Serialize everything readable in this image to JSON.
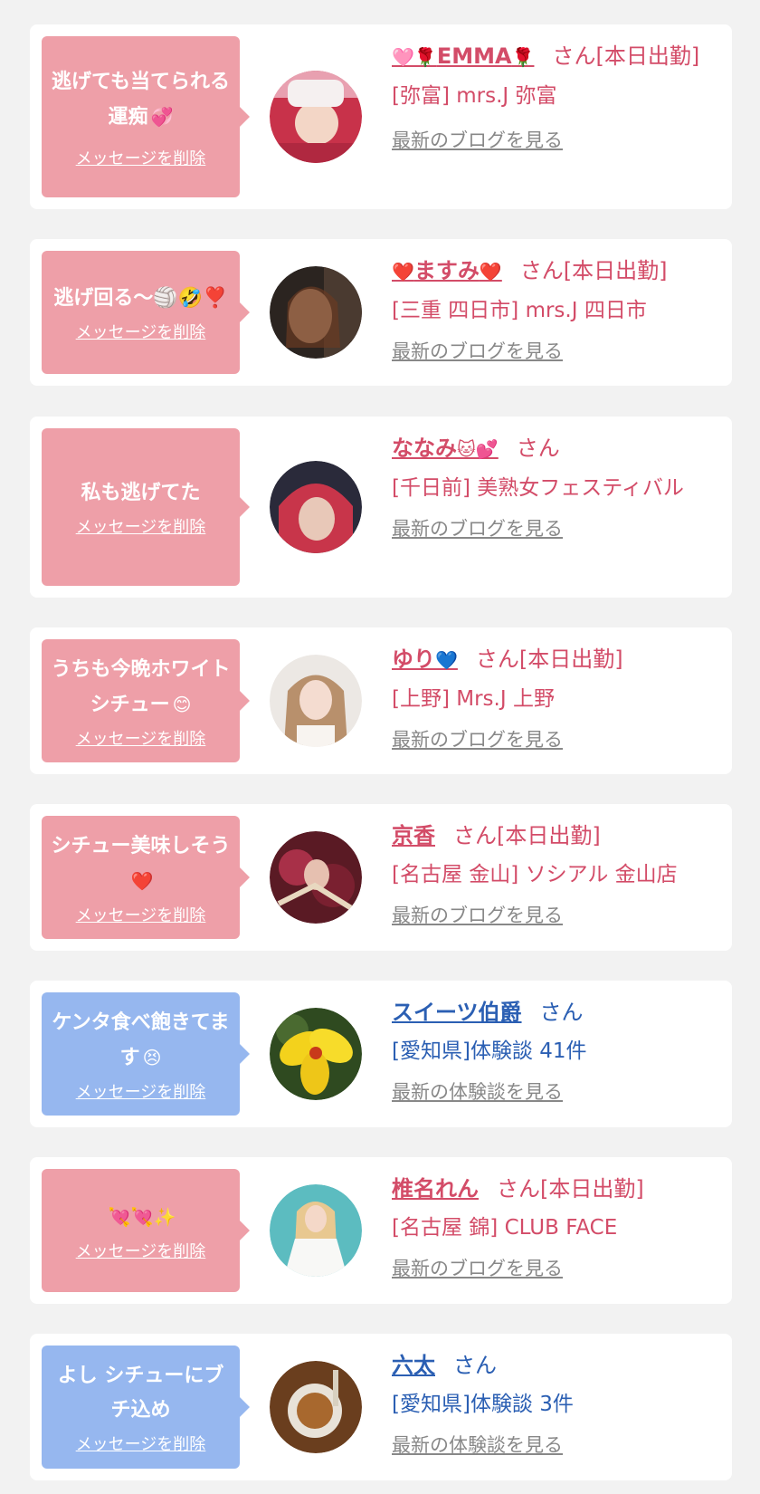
{
  "delete_label": "メッセージを削除",
  "colors": {
    "background": "#f2f2f2",
    "card": "#ffffff",
    "bubble_pink": "#ee9fa8",
    "bubble_blue": "#96b7ef",
    "name_pink": "#d34c68",
    "name_blue": "#2b5fb3",
    "link_gray": "#888888"
  },
  "items": [
    {
      "message": "逃げても当てられる運痴",
      "message_emoji": "💞",
      "bubble_color": "pink",
      "name_prefix": "🩷🌹",
      "name": "EMMA",
      "name_suffix_emoji": "🌹",
      "suffix": "さん[本日出勤]",
      "shop": "[弥富] mrs.J 弥富",
      "link": "最新のブログを見る"
    },
    {
      "message": "逃げ回る〜🏐🤣❣️",
      "message_emoji": "",
      "bubble_color": "pink",
      "name_prefix": "❤️",
      "name": "ますみ",
      "name_suffix_emoji": "❤️",
      "suffix": "さん[本日出勤]",
      "shop": "[三重 四日市] mrs.J 四日市",
      "link": "最新のブログを見る"
    },
    {
      "message": "私も逃げてた",
      "message_emoji": "",
      "bubble_color": "pink",
      "name_prefix": "",
      "name": "ななみ",
      "name_suffix_emoji": "🐱💕",
      "suffix": "さん",
      "shop": "[千日前] 美熟女フェスティバル",
      "link": "最新のブログを見る"
    },
    {
      "message": "うちも今晩ホワイトシチュー",
      "message_emoji": "😊",
      "bubble_color": "pink",
      "name_prefix": "",
      "name": "ゆり",
      "name_suffix_emoji": "💙",
      "suffix": "さん[本日出勤]",
      "shop": "[上野] Mrs.J 上野",
      "link": "最新のブログを見る"
    },
    {
      "message": "シチュー美味しそう",
      "message_emoji": "❤️",
      "bubble_color": "pink",
      "name_prefix": "",
      "name": "京香",
      "name_suffix_emoji": "",
      "suffix": "さん[本日出勤]",
      "shop": "[名古屋 金山] ソシアル 金山店",
      "link": "最新のブログを見る"
    },
    {
      "message": "ケンタ食べ飽きてます",
      "message_emoji": "😣",
      "bubble_color": "blue",
      "name_prefix": "",
      "name": "スイーツ伯爵",
      "name_suffix_emoji": "",
      "suffix": "さん",
      "shop": "[愛知県]体験談 41件",
      "link": "最新の体験談を見る"
    },
    {
      "message": "",
      "message_emoji": "💘💘✨",
      "bubble_color": "pink",
      "name_prefix": "",
      "name": "椎名れん",
      "name_suffix_emoji": "",
      "suffix": "さん[本日出勤]",
      "shop": "[名古屋 錦] CLUB FACE",
      "link": "最新のブログを見る"
    },
    {
      "message": "よし シチューにブチ込め",
      "message_emoji": "",
      "bubble_color": "blue",
      "name_prefix": "",
      "name": "六太",
      "name_suffix_emoji": "",
      "suffix": "さん",
      "shop": "[愛知県]体験談 3件",
      "link": "最新の体験談を見る"
    }
  ]
}
